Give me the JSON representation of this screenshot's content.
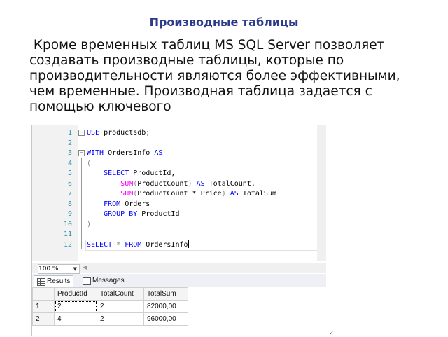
{
  "slide": {
    "title": "Производные таблицы",
    "text": " Кроме временных таблиц MS SQL Server позволяет создавать производные таблицы, которые по производительности являются более эффективными, чем временные. Производная таблица задается с помощью ключевого"
  },
  "editor": {
    "line_numbers": [
      "1",
      "2",
      "3",
      "4",
      "5",
      "6",
      "7",
      "8",
      "9",
      "10",
      "11",
      "12"
    ],
    "lines": [
      {
        "kw1": "USE",
        "rest": " productsdb;"
      },
      {
        "kw1": "",
        "rest": ""
      },
      {
        "kw1": "WITH",
        "rest": " OrdersInfo ",
        "kw2": "AS"
      },
      {
        "rest": "("
      },
      {
        "indent": "    ",
        "kw1": "SELECT",
        "rest": " ProductId,"
      },
      {
        "indent": "        ",
        "fn": "SUM",
        "p1": "(",
        "arg": "ProductCount",
        "p2": ")",
        "kw1": "AS",
        "rest": " TotalCount,"
      },
      {
        "indent": "        ",
        "fn": "SUM",
        "p1": "(",
        "arg": "ProductCount * Price",
        "p2": ")",
        "kw1": "AS",
        "rest": " TotalSum"
      },
      {
        "indent": "    ",
        "kw1": "FROM",
        "rest": " Orders"
      },
      {
        "indent": "    ",
        "kw1": "GROUP BY",
        "rest": " ProductId"
      },
      {
        "rest": ")"
      },
      {
        "rest": ""
      },
      {
        "kw1": "SELECT",
        "star": " * ",
        "kw2": "FROM",
        "rest": " OrdersInfo"
      }
    ]
  },
  "zoom": {
    "value": "100 %"
  },
  "results": {
    "tabs": {
      "results": "Results",
      "messages": "Messages"
    },
    "columns": [
      "ProductId",
      "TotalCount",
      "TotalSum"
    ],
    "rows": [
      {
        "num": "1",
        "cells": [
          "2",
          "2",
          "82000,00"
        ]
      },
      {
        "num": "2",
        "cells": [
          "4",
          "2",
          "96000,00"
        ]
      }
    ]
  }
}
